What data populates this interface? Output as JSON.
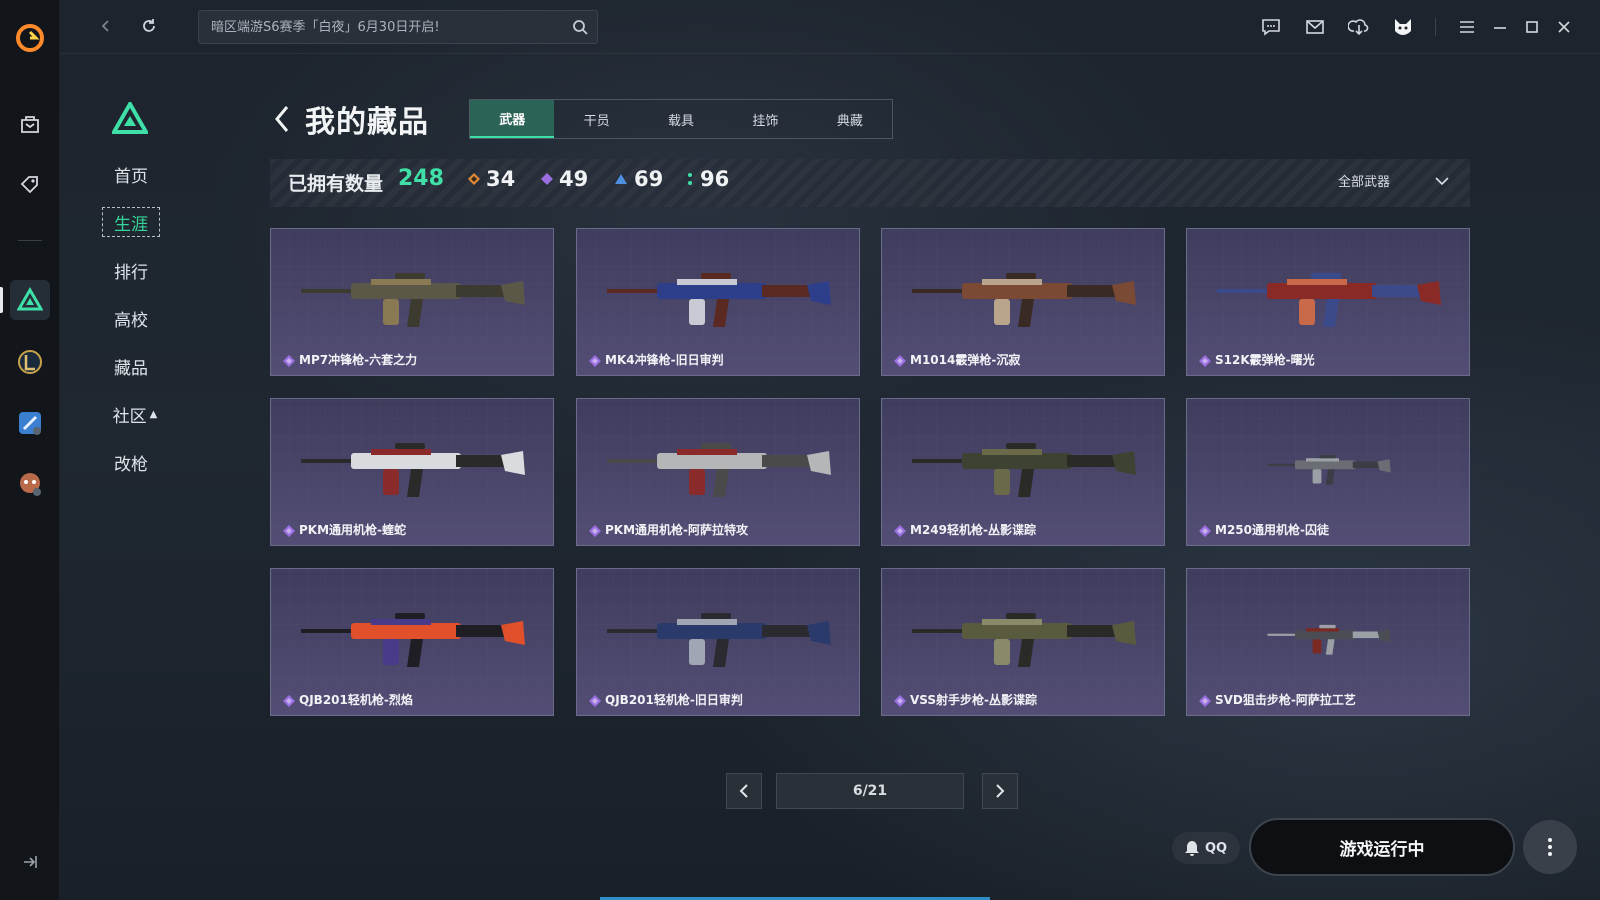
{
  "app": {
    "accent": "#3fe0a8",
    "rail_icons": [
      "app-logo-icon",
      "bag-icon",
      "tag-icon",
      "game-logo-icon",
      "league-icon",
      "tool-icon",
      "mascot-icon"
    ]
  },
  "search": {
    "placeholder": "暗区端游S6赛季「白夜」6月30日开启!"
  },
  "subnav": {
    "items": [
      {
        "label": "首页"
      },
      {
        "label": "生涯",
        "active": true
      },
      {
        "label": "排行"
      },
      {
        "label": "高校"
      },
      {
        "label": "藏品"
      },
      {
        "label": "社区"
      },
      {
        "label": "改枪"
      }
    ]
  },
  "page": {
    "title": "我的藏品"
  },
  "tabs": [
    {
      "label": "武器",
      "active": true
    },
    {
      "label": "干员"
    },
    {
      "label": "载具"
    },
    {
      "label": "挂饰"
    },
    {
      "label": "典藏"
    }
  ],
  "stats": {
    "owned_label": "已拥有数量",
    "owned_total": "248",
    "rarities": [
      {
        "value": "34",
        "color": "#e08a3a"
      },
      {
        "value": "49",
        "color": "#9a6fe0"
      },
      {
        "value": "69",
        "color": "#4f8fe0"
      },
      {
        "value": "96",
        "color": "#3fe0a8"
      }
    ],
    "filter_label": "全部武器"
  },
  "weapons": [
    {
      "name": "MP7冲锋枪-六套之力"
    },
    {
      "name": "MK4冲锋枪-旧日审判"
    },
    {
      "name": "M1014霰弹枪-沉寂"
    },
    {
      "name": "S12K霰弹枪-曙光"
    },
    {
      "name": "PKM通用机枪-蝰蛇"
    },
    {
      "name": "PKM通用机枪-阿萨拉特攻"
    },
    {
      "name": "M249轻机枪-丛影谍踪"
    },
    {
      "name": "M250通用机枪-囚徒"
    },
    {
      "name": "QJB201轻机枪-烈焰"
    },
    {
      "name": "QJB201轻机枪-旧日审判"
    },
    {
      "name": "VSS射手步枪-丛影谍踪"
    },
    {
      "name": "SVD狙击步枪-阿萨拉工艺"
    }
  ],
  "pagination": {
    "indicator": "6/21"
  },
  "footer": {
    "qq_label": "QQ",
    "run_label": "游戏运行中"
  }
}
